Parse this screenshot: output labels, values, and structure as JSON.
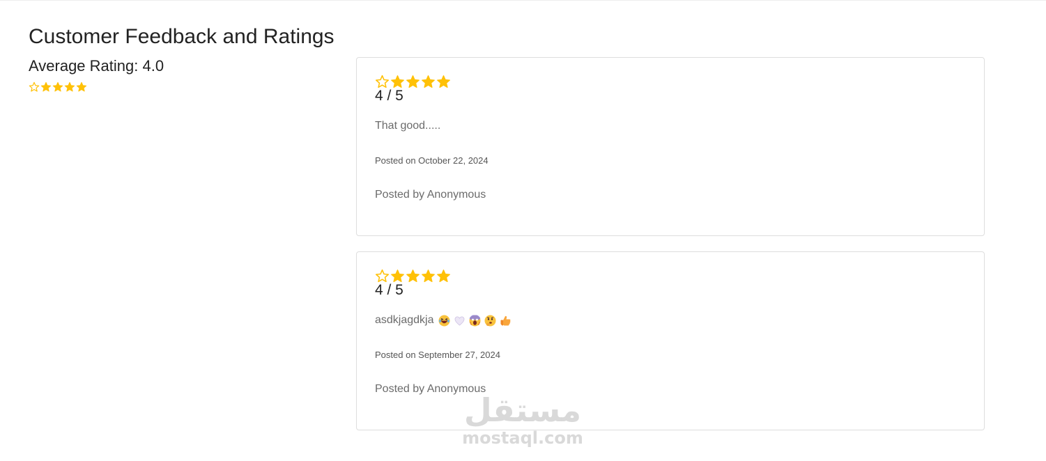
{
  "page": {
    "title": "Customer Feedback and Ratings",
    "average_label": "Average Rating: 4.0",
    "average_rating": 4.0
  },
  "reviews": [
    {
      "rating": 4,
      "score_text": "4 / 5",
      "text": "That good.....",
      "emojis": [],
      "date_text": "Posted on October 22, 2024",
      "author_text": "Posted by Anonymous"
    },
    {
      "rating": 4,
      "score_text": "4 / 5",
      "text": "asdkjagdkja",
      "emojis": [
        "laughing-emoji",
        "white-heart-emoji",
        "screaming-emoji",
        "thinking-emoji",
        "thumbs-up-emoji"
      ],
      "date_text": "Posted on September 27, 2024",
      "author_text": "Posted by Anonymous"
    }
  ],
  "watermark": {
    "arabic": "مستقل",
    "latin": "mostaql.com"
  },
  "colors": {
    "star_filled": "#FFC107",
    "star_outline": "#FFC107",
    "text_primary": "#222222",
    "text_muted": "#6b6b6b",
    "card_border": "#dddddd",
    "watermark": "#d9d9d9"
  },
  "icons": {
    "empty_star": "star-outline-icon",
    "full_star": "star-filled-icon"
  }
}
